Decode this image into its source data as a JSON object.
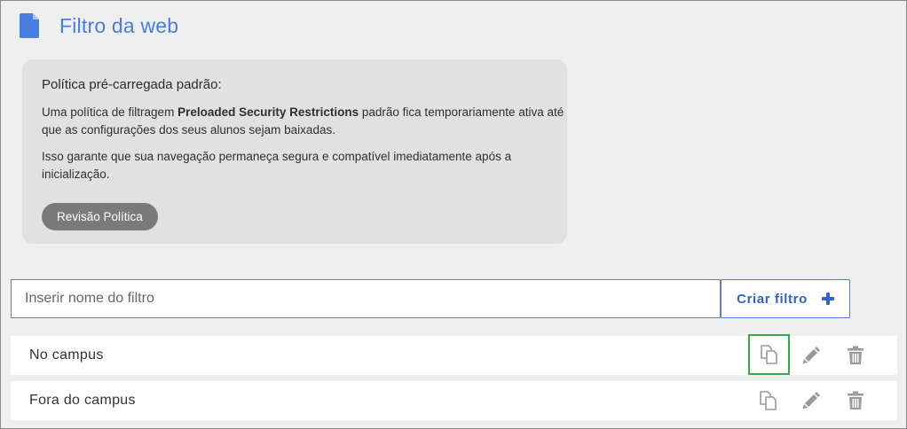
{
  "header": {
    "title": "Filtro da web",
    "icon": "document-icon",
    "accent_color": "#4a7de0"
  },
  "policy": {
    "heading": "Política pré-carregada padrão:",
    "p1_before": "Uma política de filtragem ",
    "p1_bold": "Preloaded Security Restrictions",
    "p1_after": " padrão fica temporariamente ativa até que as configurações dos seus alunos sejam baixadas.",
    "p2": "Isso garante que sua navegação permaneça segura e compatível imediatamente após a inicialização.",
    "review_button": "Revisão Política"
  },
  "create": {
    "input_placeholder": "Inserir nome do filtro",
    "input_value": "",
    "button_label": "Criar filtro",
    "button_icon": "plus-icon"
  },
  "filters": [
    {
      "name": "No campus",
      "actions": [
        "copy-icon",
        "pencil-icon",
        "trash-icon"
      ],
      "copy_highlighted": true
    },
    {
      "name": "Fora do campus",
      "actions": [
        "copy-icon",
        "pencil-icon",
        "trash-icon"
      ],
      "copy_highlighted": false
    }
  ]
}
